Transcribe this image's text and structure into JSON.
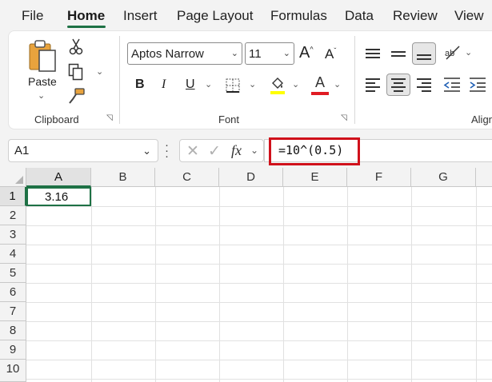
{
  "tabs": [
    "File",
    "Home",
    "Insert",
    "Page Layout",
    "Formulas",
    "Data",
    "Review",
    "View"
  ],
  "active_tab": "Home",
  "clipboard": {
    "paste_label": "Paste",
    "group_label": "Clipboard"
  },
  "font": {
    "name": "Aptos Narrow",
    "size": "11",
    "group_label": "Font",
    "bold": "B",
    "italic": "I",
    "underline": "U",
    "font_color_glyph": "A",
    "grow_glyph": "A",
    "shrink_glyph": "A"
  },
  "alignment": {
    "group_label": "Align"
  },
  "colors": {
    "accent": "#1e7145",
    "highlight": "#ffff00",
    "font_color": "#e01b24",
    "callout": "#d0111b"
  },
  "formula_bar": {
    "name_box": "A1",
    "fx": "fx",
    "formula": "=10^(0.5)"
  },
  "sheet": {
    "columns": [
      "A",
      "B",
      "C",
      "D",
      "E",
      "F",
      "G"
    ],
    "rows": [
      "1",
      "2",
      "3",
      "4",
      "5",
      "6",
      "7",
      "8",
      "9",
      "10"
    ],
    "cells": {
      "A1": "3.16"
    }
  }
}
